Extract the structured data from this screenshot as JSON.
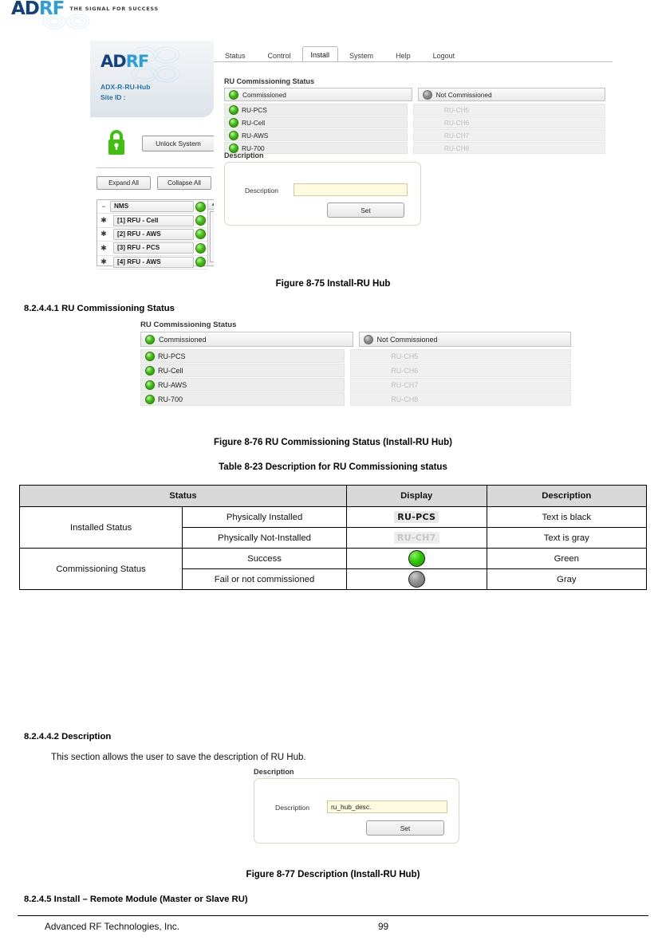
{
  "page_header": {
    "logo_ad": "AD",
    "logo_rf": "RF",
    "tagline": "THE SIGNAL FOR SUCCESS"
  },
  "app": {
    "brand": {
      "logo_ad": "AD",
      "logo_rf": "RF",
      "model": "ADX-R-RU-Hub",
      "site_id": "Site ID :"
    },
    "tabs": [
      {
        "label": "Status",
        "active": false
      },
      {
        "label": "Control",
        "active": false
      },
      {
        "label": "Install",
        "active": true
      },
      {
        "label": "System",
        "active": false
      },
      {
        "label": "Help",
        "active": false
      },
      {
        "label": "Logout",
        "active": false
      }
    ],
    "lock": {
      "icon": "padlock-icon",
      "unlock_label": "Unlock System"
    },
    "tree_buttons": {
      "expand": "Expand All",
      "collapse": "Collapse All"
    },
    "tree": [
      {
        "marker": "−",
        "label": "NMS",
        "led": "green"
      },
      {
        "marker": "✱",
        "label": "[1] RFU - Cell",
        "led": "green"
      },
      {
        "marker": "✱",
        "label": "[2] RFU - AWS",
        "led": "green"
      },
      {
        "marker": "✱",
        "label": "[3] RFU - PCS",
        "led": "green"
      },
      {
        "marker": "✱",
        "label": "[4] RFU - AWS",
        "led": "green"
      }
    ],
    "commissioning": {
      "section_title": "RU Commissioning Status",
      "header_left": "Commissioned",
      "header_right": "Not Commissioned",
      "rows": [
        {
          "left": "RU-PCS",
          "right": "RU-CH5"
        },
        {
          "left": "RU-Cell",
          "right": "RU-CH6"
        },
        {
          "left": "RU-AWS",
          "right": "RU-CH7"
        },
        {
          "left": "RU-700",
          "right": "RU-CH8"
        }
      ]
    },
    "description": {
      "section_title": "Description",
      "field_label": "Description",
      "value": "",
      "placeholder": "",
      "set_label": "Set"
    }
  },
  "figure_75_caption": "Figure 8-75   Install-RU Hub",
  "heading_1": "8.2.4.4.1    RU Commissioning Status",
  "figure_76": {
    "section_title": "RU Commissioning Status",
    "header_left": "Commissioned",
    "header_right": "Not Commissioned",
    "rows": [
      {
        "left": "RU-PCS",
        "right": "RU-CH5"
      },
      {
        "left": "RU-Cell",
        "right": "RU-CH6"
      },
      {
        "left": "RU-AWS",
        "right": "RU-CH7"
      },
      {
        "left": "RU-700",
        "right": "RU-CH8"
      }
    ]
  },
  "figure_76_caption": "Figure 8-76   RU Commissioning Status (Install-RU Hub)",
  "table_8_23": {
    "caption": "Table 8-23     Description for RU Commissioning status",
    "headers": [
      "Status",
      "Display",
      "Description"
    ],
    "groups": [
      {
        "name": "Installed Status",
        "rows": [
          {
            "condition": "Physically Installed",
            "display_type": "text-black",
            "display_text": "RU-PCS",
            "description": "Text is black"
          },
          {
            "condition": "Physically Not-Installed",
            "display_type": "text-gray",
            "display_text": "RU-CH7",
            "description": "Text is gray"
          }
        ]
      },
      {
        "name": "Commissioning  Status",
        "rows": [
          {
            "condition": "Success",
            "display_type": "led-green",
            "display_text": "",
            "description": "Green"
          },
          {
            "condition": "Fail or not commissioned",
            "display_type": "led-gray",
            "display_text": "",
            "description": "Gray"
          }
        ]
      }
    ]
  },
  "heading_2": "8.2.4.4.2    Description",
  "body_text_1": "This section allows the user to save the description of RU Hub.",
  "figure_77": {
    "section_title": "Description",
    "field_label": "Description",
    "value": "ru_hub_desc.",
    "set_label": "Set"
  },
  "figure_77_caption": "Figure 8-77   Description (Install-RU Hub)",
  "heading_3": "8.2.4.5   Install – Remote Module (Master or Slave RU)",
  "footer": {
    "company": "Advanced RF Technologies, Inc.",
    "page_number": "99"
  },
  "colors": {
    "led_green": "#3fc010",
    "led_gray": "#8e8e8e",
    "brand_blue": "#2673a8",
    "logo_dark_blue": "#15417e",
    "logo_light_blue": "#2e9fd6",
    "input_yellow": "#fcfbdf",
    "table_header_gray": "#d8d8d8"
  }
}
